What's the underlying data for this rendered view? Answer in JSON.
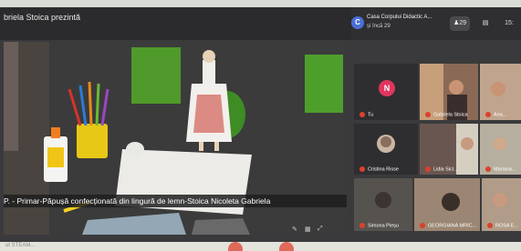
{
  "presenter": {
    "label": "briela Stoica prezintă"
  },
  "meeting": {
    "logo_letter": "C",
    "title": "Casa Corpului Didactic A...",
    "subtitle": "și încă 29",
    "people_label": "29",
    "chat_label": "",
    "time_label": "15:"
  },
  "share": {
    "caption": "P. - Primar-Păpușă confecționată din lingură de lemn-Stoica Nicoleta Gabriela"
  },
  "participants": [
    {
      "name": "Tu",
      "avatar_letter": "N",
      "avatar_color": "#e0365f"
    },
    {
      "name": "Gabriela Stoica"
    },
    {
      "name": "Ana..."
    },
    {
      "name": "Cristina Risse"
    },
    {
      "name": "Lidia Sicl..."
    },
    {
      "name": "Mariana..."
    },
    {
      "name": "Simona Pieșu"
    },
    {
      "name": "GEORGIANA MRIC..."
    },
    {
      "name": "ROSA E..."
    }
  ],
  "bottom": {
    "text": "ut STEAM..."
  },
  "colors": {
    "mic_muted": "#d9412e",
    "avatar_tu": "#e0365f",
    "share_bg": "#2a2a2a"
  }
}
